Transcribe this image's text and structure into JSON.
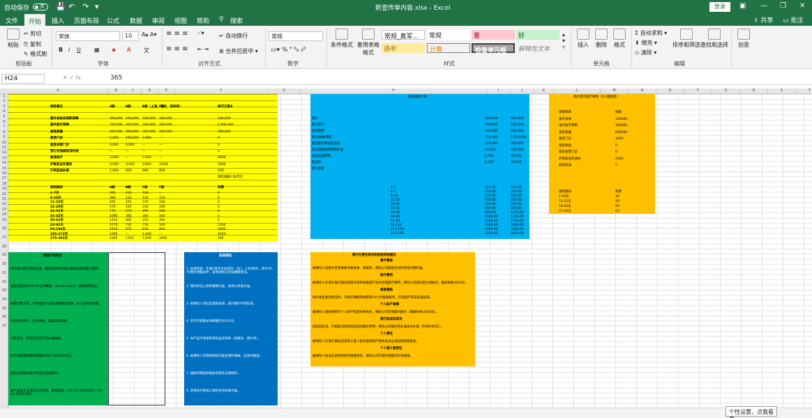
{
  "titlebar": {
    "autosave": "自动保存",
    "toggle": "关",
    "filename": "新宣传单内容.xlsx",
    "app": "Excel",
    "login": "登录",
    "minimize": "—",
    "restore": "❐",
    "close": "✕"
  },
  "tabs": [
    "文件",
    "开始",
    "插入",
    "页面布局",
    "公式",
    "数据",
    "审阅",
    "视图",
    "帮助"
  ],
  "search": "搜索",
  "share": "共享",
  "comments": "批注",
  "ribbon": {
    "paste": "粘贴",
    "cut": "剪切",
    "copy": "复制",
    "format_painter": "格式刷",
    "clipboard": "剪贴板",
    "font_name": "宋体",
    "font_size": "10",
    "font": "字体",
    "wrap": "自动换行",
    "merge": "合并后居中",
    "alignment": "对齐方式",
    "number_format": "常规",
    "number": "数字",
    "cond_format": "条件格式",
    "table_format": "套用表格格式",
    "styles": [
      "常规_奥军...",
      "常规",
      "差",
      "好",
      "适中",
      "计算",
      "检查单元格",
      "解释性文本"
    ],
    "styles_group": "样式",
    "insert": "插入",
    "delete": "删除",
    "format": "格式",
    "cells": "单元格",
    "autosum": "自动求和",
    "fill": "填充",
    "clear": "清除",
    "sort": "排序和筛选",
    "find": "查找和选择",
    "editing": "编辑",
    "ideas": "创意"
  },
  "formula_bar": {
    "name": "H24",
    "value": "365"
  },
  "columns": [
    "A",
    "B",
    "C",
    "D",
    "E",
    "F",
    "G",
    "H",
    "I",
    "J",
    "K",
    "L",
    "M",
    "N",
    "O",
    "P",
    "Q",
    "R",
    "S",
    "T",
    "U"
  ],
  "rows": [
    "1",
    "2",
    "3",
    "4",
    "5",
    "6",
    "7",
    "8",
    "9",
    "10",
    "11",
    "12",
    "13",
    "14",
    "15",
    "16",
    "17",
    "18",
    "19",
    "20",
    "21",
    "22",
    "23",
    "24",
    "25",
    "26",
    "27",
    "28",
    "29",
    "30",
    "31",
    "32",
    "33",
    "34",
    "35",
    "36",
    "37"
  ],
  "yellow_table": {
    "header": [
      "保险意见",
      "A款",
      "B款",
      "B款（上海、北京、深圳单）",
      "F款",
      "保守方案A"
    ],
    "rows": [
      [
        "意外身故及残疾保障",
        "300,000",
        "100,000",
        "100,000",
        "300,000",
        "100,000"
      ],
      [
        "意外医疗保障",
        "700,000",
        "300,000",
        "300,000",
        "300,000",
        "1,000,000"
      ],
      [
        "紧急救援",
        "400,000",
        "300,000",
        "300,000",
        "300,000",
        "300,000"
      ],
      [
        "紧急门诊",
        "5,000",
        "150,000",
        "3,000",
        "—",
        "0"
      ],
      [
        "紧急住院门诊",
        "4,000",
        "4,000",
        "—",
        "—",
        "0"
      ],
      [
        "预订住宿被取消补偿",
        "—",
        "—",
        "—",
        "—",
        "0"
      ],
      [
        "紧急医疗",
        "5,000",
        "—",
        "5,000",
        "—",
        "8000"
      ],
      [
        "护照及证件遗失",
        "3,000",
        "3,000",
        "3,000",
        "3,000",
        "2000"
      ],
      [
        "行李延误补偿",
        "1,000",
        "800",
        "800",
        "800",
        "500"
      ]
    ],
    "note1": "保险金额人民币元",
    "header2": [
      "保险期间",
      "A款",
      "B款",
      "C款",
      "F款",
      "保费"
    ],
    "rows2": [
      [
        "1-7天",
        "365",
        "165",
        "150",
        "—",
        "0"
      ],
      [
        "8-10天",
        "380",
        "133",
        "130",
        "150",
        "0"
      ],
      [
        "11-15天",
        "495",
        "165",
        "150",
        "180",
        "0"
      ],
      [
        "16-20天",
        "570",
        "193",
        "210",
        "190",
        "0"
      ],
      [
        "21-31天",
        "770",
        "273",
        "290",
        "280",
        "0"
      ],
      [
        "31-45天",
        "1090",
        "385",
        "300",
        "330",
        "0"
      ],
      [
        "45-62天",
        "1255",
        "465",
        "330",
        "380",
        "0"
      ],
      [
        "63-92天",
        "1570",
        "735",
        "730",
        "500",
        "1500"
      ],
      [
        "93-184天",
        "2930",
        "935",
        "930",
        "800",
        "3000"
      ],
      [
        "185-273天",
        "3395",
        "—",
        "1,000",
        "—",
        "4500"
      ],
      [
        "275-365天",
        "4365",
        "1315",
        "1,000",
        "1600",
        "365"
      ]
    ]
  },
  "blue_table": {
    "title": "旅游保障计划",
    "rows": [
      "意外",
      "意外医疗",
      "住院费用",
      "意外身故/残疾",
      "紧急医疗转运及送返",
      "紧急救援住院费用补偿",
      "身故运送费用",
      "客运险",
      "保险金额"
    ],
    "col1": [
      "300,000",
      "300,000",
      "300,000",
      "750,000",
      "150,000",
      "20,000",
      "5,000",
      "5,000"
    ],
    "col2": [
      "500,000",
      "500,000",
      "500,000",
      "1,000,000",
      "300,000",
      "100,000",
      "60,000",
      "20,000"
    ],
    "days": [
      "1-3",
      "4-7",
      "8-10",
      "11-15",
      "16-22",
      "23-31",
      "32-45",
      "46-60",
      "61-90",
      "91-120",
      "121-150",
      "151-180"
    ],
    "p1": [
      "165.00",
      "215.00",
      "275.00",
      "405.00",
      "540.00",
      "690.00",
      "850.00",
      "1000.00",
      "1300.00",
      "1600.00",
      "1900.00",
      "2200.00"
    ],
    "p2": [
      "200.00",
      "310.00",
      "400.00",
      "530.00",
      "700.00",
      "900.00",
      "1170.00",
      "1350.00",
      "1700.00",
      "2000.00",
      "2350.00",
      "2650.00"
    ]
  },
  "orange_small": {
    "title": "境外意外医疗保障（5人团起保）",
    "rows": [
      "保障项目",
      "意外身故",
      "境外医疗费用",
      "紧急救援",
      "紧急门诊",
      "住院津贴",
      "紧急住院门诊",
      "护照及证件遗失",
      "航班延误"
    ],
    "values": [
      "保额",
      "100000",
      "300000",
      "600000",
      "1000",
      "0",
      "0",
      "2000",
      "0"
    ],
    "days": [
      "保险期间",
      "1-10天",
      "11-15天",
      "16-20天",
      "21-30天"
    ],
    "prices": [
      "保费",
      "30",
      "40",
      "50",
      "60"
    ]
  },
  "green_box": {
    "title": "保险产品特点",
    "items": [
      "境外意外医疗保障全面，覆盖多种突发意外事故及疾病医疗费用。",
      "紧急救援服务24小时全球覆盖（Travel Guard）保障旅客安全。",
      "保费计算灵活，可根据旅行天数选择相应保费，多人团体享优惠。",
      "支持电子保单，出单快捷，理赔流程简便。",
      "行李延误、航班延误等多项补偿保障。",
      "意外身故及残疾保障最高可达人民币30万元。",
      "提供全球紧急医疗转运及送返服务。",
      "本产品由专业保险公司承保，客服热线：400-81-18189443 / 95-81-65957445"
    ]
  },
  "dblue_box": {
    "title": "投保须知",
    "items": [
      "1. 投保年龄：年满1周岁至80周岁（含）。3-80周岁。其中70-79周岁保额减半，投保须如实告知健康状况。",
      "2. 保险责任以保单载明为准，具体以条款为准。",
      "3. 被保险人须在出境前投保，境外期间不得投保。",
      "4. 单次行程最长保障期间为365天。",
      "5. 本产品不承保高风险运动项目（如跳伞、潜水等）。",
      "6. 被保险人在保险期间内发生保险事故，应及时报案。",
      "7. 理赔时需提供相关单据及证明材料。",
      "8. 其他未尽事宜以保险合同条款为准。"
    ]
  },
  "orange_box": {
    "title": "旅行社责任险及附加险特别提示",
    "items": [
      "意外事故",
      "被保险人因意外伤害事故导致身故、残疾的，保险公司按照合同约定给付保险金。",
      "医疗费用",
      "被保险人在境外旅行期间因意外或突发疾病产生的合理医疗费用，保险公司按约定比例赔付。最高限额3000元。",
      "紧急援助",
      "境外发生紧急情况时，可拨打救援热线获取24小时援助服务，包括医疗转运及送返等。",
      "个人财产保障",
      "被保险人随身携带的个人财产因意外损失的，保险公司在限额内赔付（限额RMB2000元）。",
      "旅行延误及取消",
      "因航班延误、行程取消等原因造成的额外费用，保险公司按约定标准给付补偿（RMB500元）。",
      "个人责任",
      "被保险人在旅行期间造成第三者人身伤害或财产损失依法应承担的赔偿责任。",
      "个人第三者责任",
      "被保险人依法应承担的经济赔偿责任，保险公司在保险金额内负责赔偿。"
    ]
  },
  "tooltip": "个性设置，点我看看"
}
